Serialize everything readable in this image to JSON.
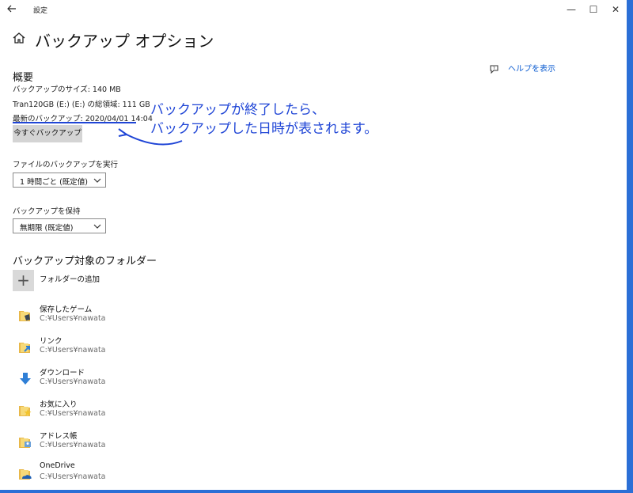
{
  "titlebar": {
    "back_icon": "back-arrow-icon",
    "title": "設定",
    "min": "—",
    "max": "☐",
    "close": "✕"
  },
  "page": {
    "home_icon": "home-icon",
    "title": "バックアップ オプション",
    "help_link": "ヘルプを表示"
  },
  "overview": {
    "heading": "概要",
    "backup_size": "バックアップのサイズ: 140 MB",
    "drive_info": "Tran120GB (E:) (E:) の総領域: 111 GB",
    "last_backup": "最新のバックアップ: 2020/04/01 14:04",
    "backup_now_button": "今すぐバックアップ"
  },
  "annotation": {
    "line1": "バックアップが終了したら、",
    "line2": "バックアップした日時が表されます。",
    "color": "#1f45d6"
  },
  "settings": {
    "run_label": "ファイルのバックアップを実行",
    "run_value": "1 時間ごと (既定値)",
    "keep_label": "バックアップを保持",
    "keep_value": "無期限 (既定値)"
  },
  "folders": {
    "heading": "バックアップ対象のフォルダー",
    "add_label": "フォルダーの追加",
    "items": [
      {
        "name": "保存したゲーム",
        "path": "C:¥Users¥nawata",
        "icon": "saved-games-folder-icon"
      },
      {
        "name": "リンク",
        "path": "C:¥Users¥nawata",
        "icon": "links-folder-icon"
      },
      {
        "name": "ダウンロード",
        "path": "C:¥Users¥nawata",
        "icon": "downloads-folder-icon"
      },
      {
        "name": "お気に入り",
        "path": "C:¥Users¥nawata",
        "icon": "favorites-folder-icon"
      },
      {
        "name": "アドレス帳",
        "path": "C:¥Users¥nawata",
        "icon": "contacts-folder-icon"
      },
      {
        "name": "OneDrive",
        "path": "C:¥Users¥nawata",
        "icon": "onedrive-folder-icon"
      }
    ]
  }
}
